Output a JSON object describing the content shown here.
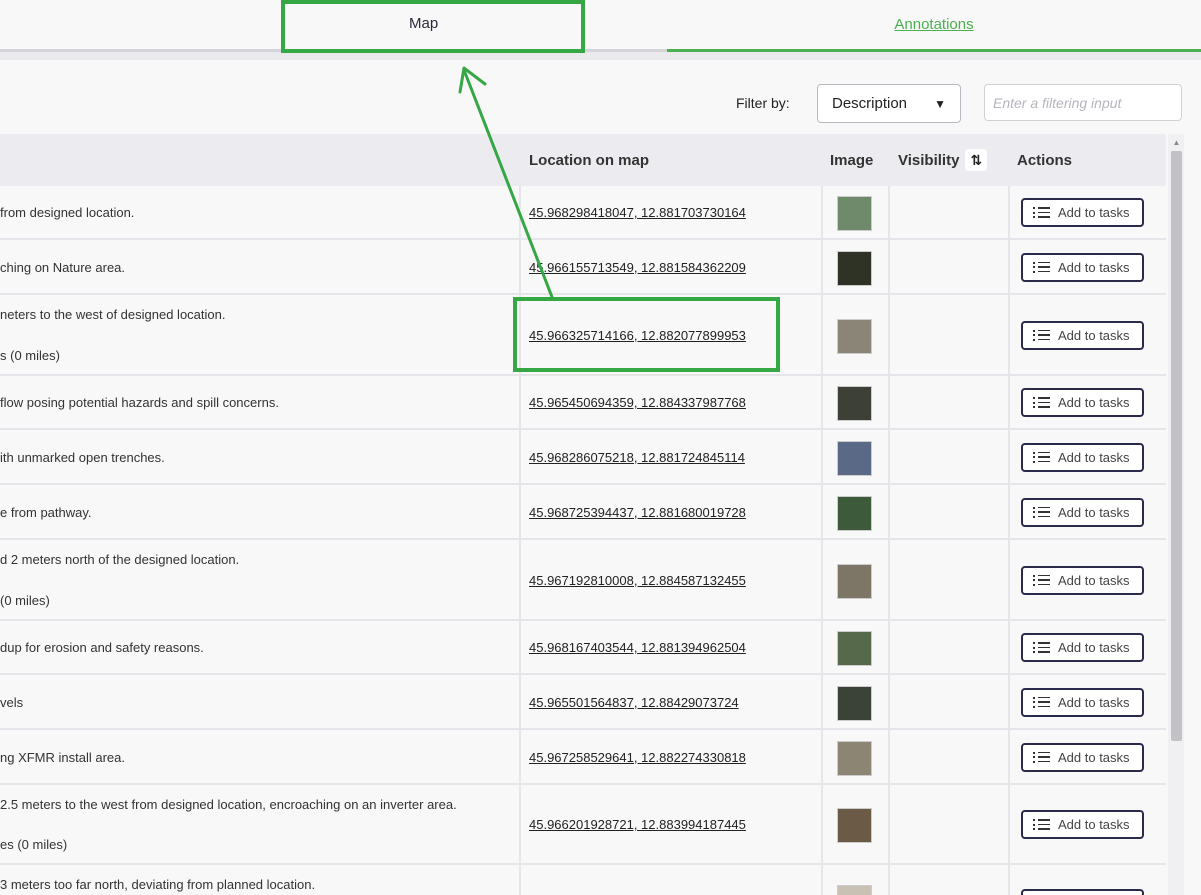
{
  "tabs": {
    "map_label": "Map",
    "annotations_label": "Annotations"
  },
  "filter": {
    "label": "Filter by:",
    "selected": "Description",
    "placeholder": "Enter a filtering input"
  },
  "table": {
    "headers": {
      "location": "Location on map",
      "image": "Image",
      "visibility": "Visibility",
      "actions": "Actions"
    },
    "add_label": "Add to tasks",
    "rows": [
      {
        "desc1": "from designed location.",
        "desc2": "",
        "location": "45.968298418047, 12.881703730164",
        "thumb_color": "#6f8a6a"
      },
      {
        "desc1": "ching on Nature area.",
        "desc2": "",
        "location": "45.966155713549, 12.881584362209",
        "thumb_color": "#2f3326"
      },
      {
        "desc1": "neters to the west of designed location.",
        "desc2": "s (0 miles)",
        "location": "45.966325714166, 12.882077899953",
        "thumb_color": "#8a8576"
      },
      {
        "desc1": "flow posing potential hazards and spill concerns.",
        "desc2": "",
        "location": "45.965450694359, 12.884337987768",
        "thumb_color": "#3c4036"
      },
      {
        "desc1": "ith unmarked open trenches.",
        "desc2": "",
        "location": "45.968286075218, 12.881724845114",
        "thumb_color": "#5a6a86"
      },
      {
        "desc1": "e from pathway.",
        "desc2": "",
        "location": "45.968725394437, 12.881680019728",
        "thumb_color": "#3d5a3a"
      },
      {
        "desc1": "d 2 meters north of the designed location.",
        "desc2": "(0 miles)",
        "location": "45.967192810008, 12.884587132455",
        "thumb_color": "#7d7666"
      },
      {
        "desc1": "dup for erosion and safety reasons.",
        "desc2": "",
        "location": "45.968167403544, 12.881394962504",
        "thumb_color": "#56694a"
      },
      {
        "desc1": "vels",
        "desc2": "",
        "location": "45.965501564837, 12.88429073724",
        "thumb_color": "#3b4237"
      },
      {
        "desc1": "ng XFMR install area.",
        "desc2": "",
        "location": "45.967258529641, 12.882274330818",
        "thumb_color": "#8c8574"
      },
      {
        "desc1": "2.5 meters to the west from designed location, encroaching on an inverter area.",
        "desc2": "es (0 miles)",
        "location": "45.966201928721, 12.883994187445",
        "thumb_color": "#6b5a46"
      },
      {
        "desc1": "3 meters too far north, deviating from planned location.",
        "desc2": "",
        "location": "",
        "thumb_color": "#c9c2b4"
      }
    ]
  },
  "colors": {
    "accent_green": "#4bb04f",
    "annotation_green": "#35a745",
    "button_border": "#2a2a4a"
  },
  "icons": {
    "sort": "sort-arrows-icon",
    "list": "list-icon",
    "dropdown": "chevron-down-icon"
  }
}
